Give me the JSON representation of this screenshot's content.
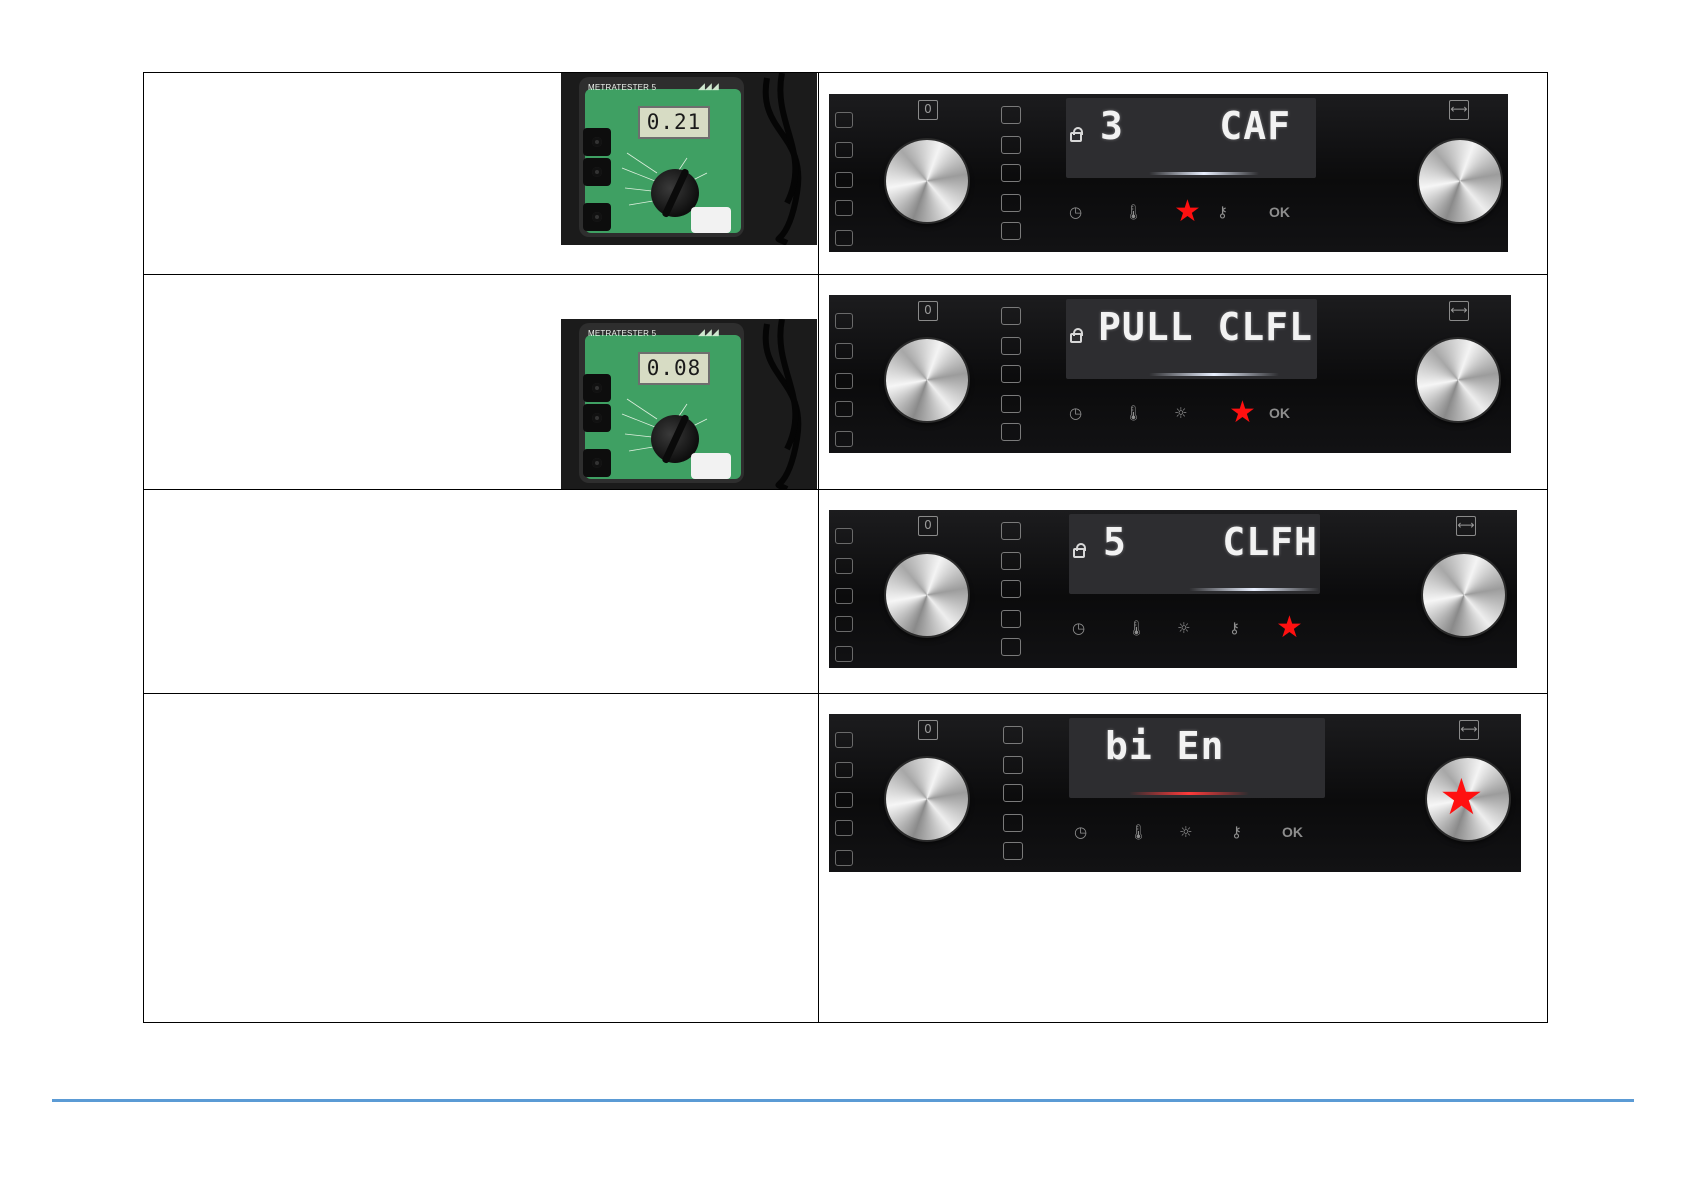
{
  "meter_photos": [
    {
      "brand_label": "METRATESTER 5",
      "reading": "0.21"
    },
    {
      "brand_label": "METRATESTER 5",
      "reading": "0.08"
    }
  ],
  "oven_panels": [
    {
      "display_text": "3    CAF",
      "lock_visible": true,
      "glow": "white",
      "touch_keys": [
        "clock-icon",
        "thermo-icon",
        "star-highlight",
        "key-icon",
        "OK"
      ],
      "highlighted_key": "3rd touch key (red star)"
    },
    {
      "display_text": "PULL CLFL",
      "lock_visible": true,
      "glow": "white",
      "touch_keys": [
        "clock-icon",
        "thermo-icon",
        "lamp-icon",
        "star-highlight",
        "OK"
      ],
      "highlighted_key": "4th touch key (red star)"
    },
    {
      "display_text": "5    CLFH",
      "lock_visible": true,
      "glow": "white",
      "touch_keys": [
        "clock-icon",
        "thermo-icon",
        "lamp-icon",
        "key-icon",
        "star-highlight"
      ],
      "highlighted_key": "OK key (red star)"
    },
    {
      "display_text": "bi En",
      "lock_visible": false,
      "glow": "red",
      "touch_keys": [
        "clock-icon",
        "thermo-icon",
        "lamp-icon",
        "key-icon",
        "OK"
      ],
      "highlighted_key": "right knob (red star)"
    }
  ],
  "labels": {
    "ok": "OK",
    "knob_left_mark": "0",
    "star": "★",
    "footer_color": "#5b9bd5",
    "highlight_color": "#ff1010"
  }
}
